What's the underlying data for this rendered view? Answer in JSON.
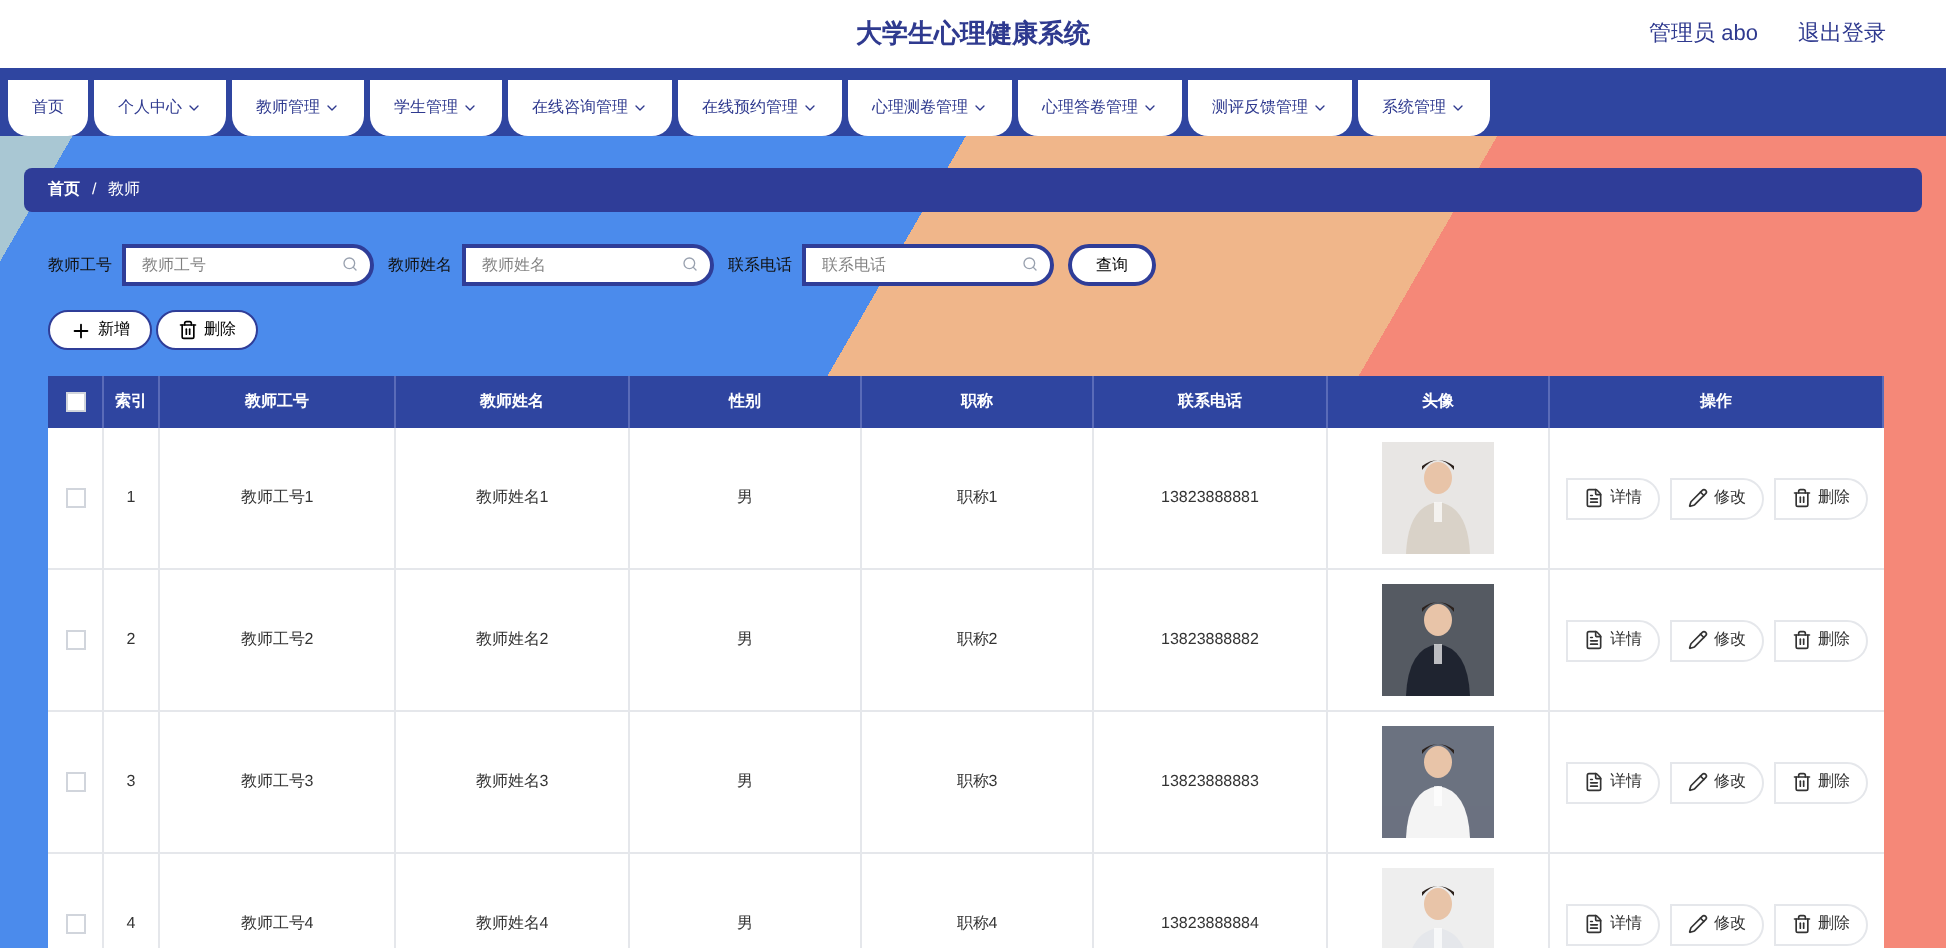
{
  "header": {
    "title": "大学生心理健康系统",
    "user": "管理员 abo",
    "logout": "退出登录"
  },
  "nav": [
    {
      "label": "首页",
      "has_menu": false
    },
    {
      "label": "个人中心",
      "has_menu": true
    },
    {
      "label": "教师管理",
      "has_menu": true
    },
    {
      "label": "学生管理",
      "has_menu": true
    },
    {
      "label": "在线咨询管理",
      "has_menu": true
    },
    {
      "label": "在线预约管理",
      "has_menu": true
    },
    {
      "label": "心理测卷管理",
      "has_menu": true
    },
    {
      "label": "心理答卷管理",
      "has_menu": true
    },
    {
      "label": "测评反馈管理",
      "has_menu": true
    },
    {
      "label": "系统管理",
      "has_menu": true
    }
  ],
  "breadcrumb": {
    "items": [
      "首页",
      "教师"
    ],
    "separator": "/"
  },
  "search": {
    "fields": [
      {
        "label": "教师工号",
        "placeholder": "教师工号"
      },
      {
        "label": "教师姓名",
        "placeholder": "教师姓名"
      },
      {
        "label": "联系电话",
        "placeholder": "联系电话"
      }
    ],
    "button": "查询"
  },
  "actions": [
    {
      "label": "新增",
      "kind": "add"
    },
    {
      "label": "删除",
      "kind": "delete"
    }
  ],
  "table": {
    "select_all_checked": false,
    "columns": [
      "索引",
      "教师工号",
      "教师姓名",
      "性别",
      "职称",
      "联系电话",
      "头像",
      "操作"
    ],
    "rows": [
      {
        "checked": false,
        "cells": [
          "1",
          "教师工号1",
          "教师姓名1",
          "男",
          "职称1",
          "13823888881"
        ],
        "avatar": {
          "kind": "picture"
        },
        "actions": [
          {
            "label": "详情",
            "kind": "detail"
          },
          {
            "label": "修改",
            "kind": "edit"
          },
          {
            "label": "删除",
            "kind": "delete"
          }
        ]
      },
      {
        "checked": false,
        "cells": [
          "2",
          "教师工号2",
          "教师姓名2",
          "男",
          "职称2",
          "13823888882"
        ],
        "avatar": {
          "kind": "picture"
        },
        "actions": [
          {
            "label": "详情",
            "kind": "detail"
          },
          {
            "label": "修改",
            "kind": "edit"
          },
          {
            "label": "删除",
            "kind": "delete"
          }
        ]
      },
      {
        "checked": false,
        "cells": [
          "3",
          "教师工号3",
          "教师姓名3",
          "男",
          "职称3",
          "13823888883"
        ],
        "avatar": {
          "kind": "picture"
        },
        "actions": [
          {
            "label": "详情",
            "kind": "detail"
          },
          {
            "label": "修改",
            "kind": "edit"
          },
          {
            "label": "删除",
            "kind": "delete"
          }
        ]
      },
      {
        "checked": false,
        "cells": [
          "4",
          "教师工号4",
          "教师姓名4",
          "男",
          "职称4",
          "13823888884"
        ],
        "avatar": {
          "kind": "picture"
        },
        "actions": [
          {
            "label": "详情",
            "kind": "detail"
          },
          {
            "label": "修改",
            "kind": "edit"
          },
          {
            "label": "删除",
            "kind": "delete"
          }
        ]
      }
    ]
  }
}
